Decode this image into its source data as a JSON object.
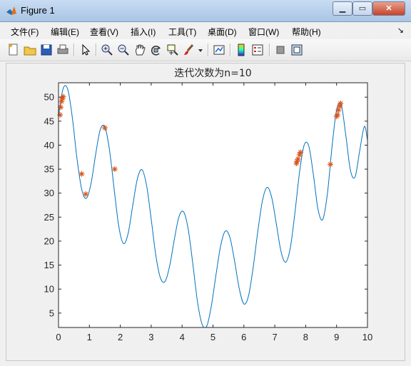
{
  "window": {
    "title": "Figure 1"
  },
  "menu": [
    "文件(F)",
    "编辑(E)",
    "查看(V)",
    "插入(I)",
    "工具(T)",
    "桌面(D)",
    "窗口(W)",
    "帮助(H)"
  ],
  "toolbar": [
    "new-figure-icon",
    "open-icon",
    "save-icon",
    "print-icon",
    "pointer-icon",
    "zoom-in-icon",
    "zoom-out-icon",
    "pan-icon",
    "rotate-icon",
    "data-cursor-icon",
    "brush-icon",
    "brush-dropdown-icon",
    "link-plot-icon",
    "colorbar-icon",
    "legend-icon",
    "hide-plot-tools-icon",
    "show-plot-tools-icon"
  ],
  "colors": {
    "curve": "#0072bd",
    "markers": "#d95319"
  },
  "chart_data": {
    "type": "line",
    "title": "迭代次数为n=10",
    "xlabel": "",
    "ylabel": "",
    "xlim": [
      0,
      10
    ],
    "ylim": [
      2,
      53
    ],
    "x_ticks": [
      0,
      1,
      2,
      3,
      4,
      5,
      6,
      7,
      8,
      9,
      10
    ],
    "y_ticks": [
      5,
      10,
      15,
      20,
      25,
      30,
      35,
      40,
      45,
      50
    ],
    "series": [
      {
        "kind": "line",
        "x": [
          0,
          0.15,
          0.3,
          0.45,
          0.6,
          0.75,
          0.9,
          1.05,
          1.2,
          1.35,
          1.5,
          1.65,
          1.8,
          1.95,
          2.1,
          2.25,
          2.4,
          2.55,
          2.7,
          2.85,
          3.0,
          3.15,
          3.3,
          3.45,
          3.6,
          3.75,
          3.9,
          4.05,
          4.2,
          4.35,
          4.5,
          4.65,
          4.8,
          4.95,
          5.1,
          5.25,
          5.4,
          5.55,
          5.7,
          5.85,
          6.0,
          6.15,
          6.3,
          6.45,
          6.6,
          6.75,
          6.9,
          7.05,
          7.2,
          7.35,
          7.5,
          7.65,
          7.8,
          7.95,
          8.1,
          8.25,
          8.4,
          8.55,
          8.7,
          8.85,
          9.0,
          9.15,
          9.3,
          9.45,
          9.6,
          9.75,
          9.9,
          10.0
        ],
        "y": [
          46.1,
          51.8,
          51.6,
          45.6,
          37.1,
          30.8,
          28.9,
          31.9,
          38.0,
          43.2,
          43.8,
          39.0,
          30.9,
          23.1,
          19.5,
          21.5,
          27.3,
          32.9,
          34.9,
          31.6,
          24.6,
          17.0,
          12.3,
          11.6,
          14.9,
          20.4,
          25.1,
          26.1,
          22.4,
          15.1,
          7.3,
          2.6,
          2.3,
          6.6,
          13.1,
          19.1,
          22.1,
          20.7,
          15.8,
          10.1,
          6.9,
          8.6,
          14.5,
          22.0,
          28.4,
          31.2,
          29.1,
          23.6,
          17.9,
          15.6,
          18.5,
          25.8,
          34.3,
          40.0,
          39.8,
          33.8,
          26.6,
          24.5,
          29.7,
          39.5,
          47.3,
          48.4,
          42.0,
          34.7,
          33.4,
          38.9,
          43.9,
          41.0
        ]
      },
      {
        "kind": "markers",
        "marker": "asterisk",
        "x": [
          0.05,
          0.07,
          0.1,
          0.13,
          0.15,
          0.75,
          0.88,
          1.5,
          1.82,
          7.7,
          7.72,
          7.75,
          7.8,
          7.83,
          8.8,
          9.0,
          9.03,
          9.06,
          9.1,
          9.13
        ],
        "y": [
          46.3,
          47.9,
          49.1,
          49.8,
          50.1,
          34.0,
          29.8,
          43.6,
          35.0,
          36.2,
          36.6,
          37.1,
          38.0,
          38.5,
          36.0,
          46.0,
          46.3,
          47.3,
          48.1,
          48.7
        ]
      }
    ]
  }
}
